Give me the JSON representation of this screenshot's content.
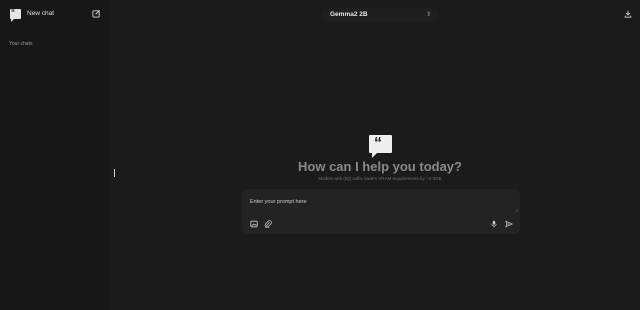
{
  "sidebar": {
    "new_chat_label": "New chat",
    "section_label": "Your chats",
    "logo_icon": "quote-icon",
    "edit_icon": "edit-icon"
  },
  "header": {
    "model_name": "Gemma2 2B",
    "model_chevron_icon": "chevron-up-down-icon",
    "download_icon": "download-icon"
  },
  "hero": {
    "icon": "quote-icon",
    "title": "How can I help you today?",
    "subtitle": "Models with (IQ) suffix lowers VRAM requirements by ~2-3GB"
  },
  "composer": {
    "placeholder": "Enter your prompt here",
    "tools": [
      "image-icon",
      "paperclip-icon"
    ],
    "actions": [
      "microphone-icon",
      "send-icon"
    ]
  },
  "colors": {
    "sidebar_bg": "#171717",
    "main_bg": "#1b1b1b",
    "composer_bg": "#232323",
    "headline": "#8a8a8a"
  }
}
